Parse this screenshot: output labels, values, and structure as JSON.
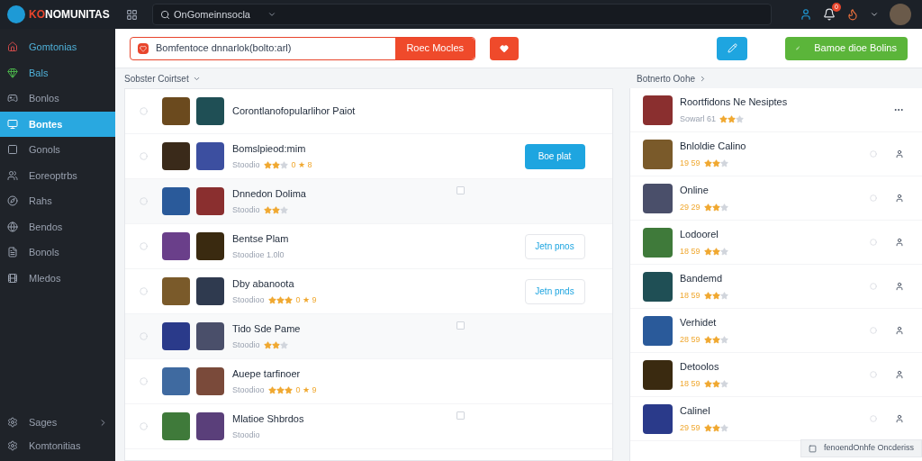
{
  "topbar": {
    "logo_accent": "KO",
    "logo_rest": "NOMUNITAS",
    "search": {
      "value": "OnGomeinnsocla"
    },
    "notification_badge": "0"
  },
  "sidebar": {
    "items": [
      {
        "label": "Gomtonias",
        "selected": false
      },
      {
        "label": "Bals",
        "selected": false
      },
      {
        "label": "Bonlos",
        "selected": false
      },
      {
        "label": "Bontes",
        "selected": true
      },
      {
        "label": "Gonols",
        "selected": false
      },
      {
        "label": "Eoreoptrbs",
        "selected": false
      },
      {
        "label": "Rahs",
        "selected": false
      },
      {
        "label": "Bendos",
        "selected": false
      },
      {
        "label": "Bonols",
        "selected": false
      },
      {
        "label": "Mledos",
        "selected": false
      }
    ],
    "footer": [
      {
        "label": "Sages",
        "expandable": true
      },
      {
        "label": "Komtonitias",
        "expandable": false
      }
    ]
  },
  "toolbar": {
    "field": {
      "value": "Bomfentoce dnnarlok(bolto:arl)"
    },
    "search_button": "Roec Mocles",
    "primary_button": "Bamoe dioe Bolins"
  },
  "left_panel": {
    "title": "Sobster Coirtset",
    "rows": [
      {
        "title": "Corontlanofopularlihor Paiot"
      },
      {
        "title": "Bomslpieod:mim",
        "meta": "Stoodio",
        "stars": 2,
        "extra": "0 ★ 8",
        "action": {
          "kind": "filled",
          "label": "Boe plat"
        }
      },
      {
        "title": "Dnnedon Dolima",
        "meta": "Stoodio",
        "stars": 2,
        "action": {
          "kind": "checkbox",
          "checked": false
        }
      },
      {
        "title": "Bentse Plam",
        "meta": "Stoodioe 1.0l0",
        "action": {
          "kind": "outline",
          "label": "Jetn pnos"
        }
      },
      {
        "title": "Dby abanoota",
        "meta": "Stoodioo",
        "stars": 3,
        "extra": "0 ★ 9",
        "action": {
          "kind": "outline",
          "label": "Jetn pnds"
        }
      },
      {
        "title": "Tido Sde Pame",
        "meta": "Stoodio",
        "stars": 2,
        "action": {
          "kind": "checkbox",
          "checked": false
        }
      },
      {
        "title": "Auepe tarfinoer",
        "meta": "Stoodioo",
        "stars": 3,
        "extra": "0 ★ 9"
      },
      {
        "title": "Mlatioe Shbrdos",
        "meta": "Stoodio",
        "action": {
          "kind": "checkbox",
          "checked": false
        }
      }
    ]
  },
  "right_panel": {
    "title": "Botnerto Oohe",
    "rows": [
      {
        "title": "Roortfidons Ne Nesiptes",
        "meta": "Sowarl 61",
        "stars": 2
      },
      {
        "title": "Bnloldie Calino",
        "meta": "19 59",
        "stars": 2
      },
      {
        "title": "Online",
        "meta": "29 29",
        "stars": 2
      },
      {
        "title": "Lodoorel",
        "meta": "18 59",
        "stars": 2
      },
      {
        "title": "Bandemd",
        "meta": "18 59",
        "stars": 2
      },
      {
        "title": "Verhidet",
        "meta": "28 59",
        "stars": 2
      },
      {
        "title": "Detoolos",
        "meta": "18 59",
        "stars": 2
      },
      {
        "title": "Calinel",
        "meta": "29 59",
        "stars": 2
      }
    ]
  },
  "toast": "fenoendOnhfe Oncderiss"
}
